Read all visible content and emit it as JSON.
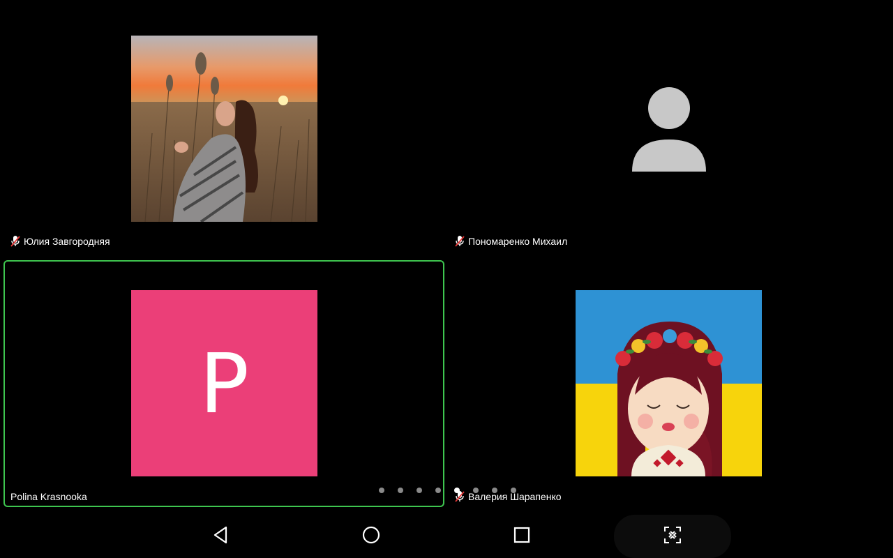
{
  "participants": [
    {
      "name": "Юлия Завгородняя",
      "muted": true
    },
    {
      "name": "Пономаренко Михаил",
      "muted": true
    },
    {
      "name": "Polina Krasnooka",
      "muted": false,
      "initial": "P",
      "avatar_color": "#eb3f78",
      "active_speaker": true
    },
    {
      "name": "Валерия Шарапенко",
      "muted": true
    }
  ],
  "pagination": {
    "pages": 8,
    "current": 5
  },
  "colors": {
    "active_border": "#3ec54f",
    "background": "#000000",
    "muted_icon": "#ffffff",
    "placeholder_avatar": "#c8c8c8"
  },
  "navbar": {
    "icons": [
      "back-icon",
      "home-icon",
      "recents-icon",
      "screenshot-scan-icon"
    ]
  }
}
